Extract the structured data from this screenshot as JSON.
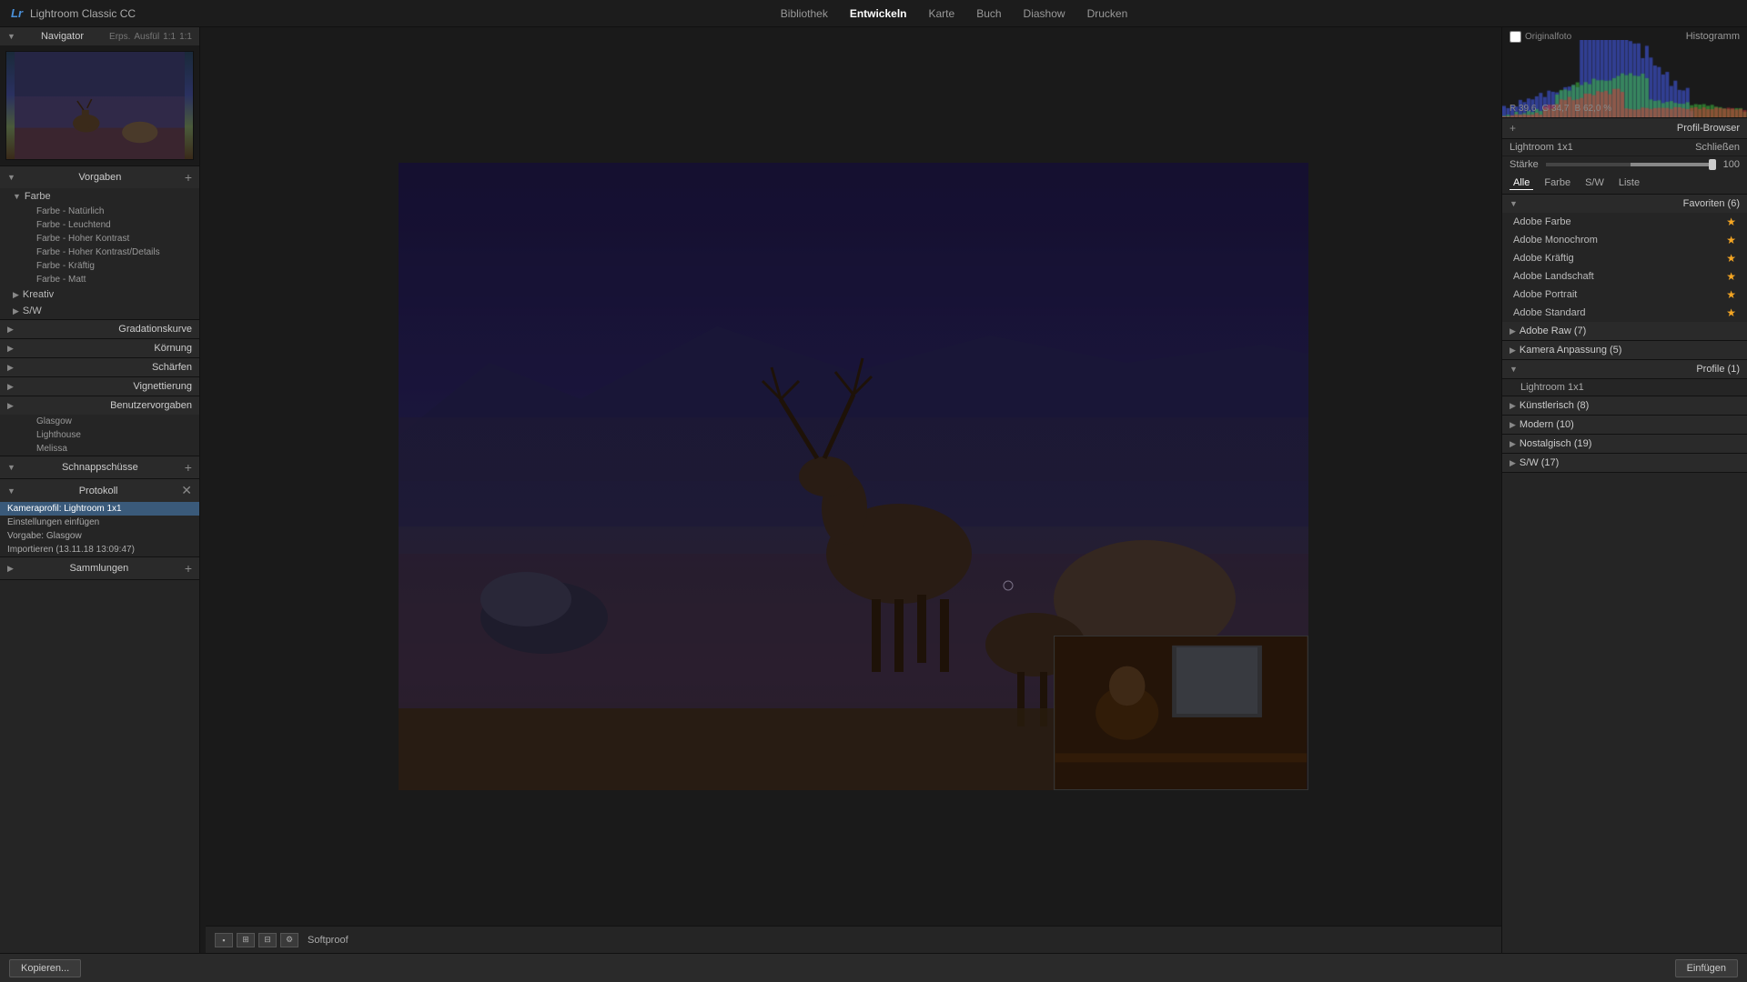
{
  "app": {
    "logo": "Lr",
    "name": "Lightroom Classic CC",
    "nav": [
      {
        "id": "bibliothek",
        "label": "Bibliothek",
        "active": false
      },
      {
        "id": "entwickeln",
        "label": "Entwickeln",
        "active": true
      },
      {
        "id": "karte",
        "label": "Karte",
        "active": false
      },
      {
        "id": "buch",
        "label": "Buch",
        "active": false
      },
      {
        "id": "diashow",
        "label": "Diashow",
        "active": false
      },
      {
        "id": "drucken",
        "label": "Drucken",
        "active": false
      }
    ]
  },
  "left_panel": {
    "navigator": {
      "title": "Navigator",
      "view_options": [
        "Erps.",
        "Ausfül",
        "1:1",
        "1:1"
      ]
    },
    "presets": {
      "title": "Vorgaben",
      "groups": [
        {
          "name": "Farbe",
          "expanded": true,
          "items": [
            {
              "label": "Farbe - Natürlich"
            },
            {
              "label": "Farbe - Leuchtend"
            },
            {
              "label": "Farbe - Hoher Kontrast"
            },
            {
              "label": "Farbe - Hoher Kontrast/Details"
            },
            {
              "label": "Farbe - Kräftig"
            },
            {
              "label": "Farbe - Matt"
            }
          ]
        },
        {
          "name": "Kreativ",
          "expanded": false,
          "items": []
        },
        {
          "name": "S/W",
          "expanded": false,
          "items": []
        }
      ]
    },
    "gradationskurve": {
      "title": "Gradationskurve"
    },
    "kornung": {
      "title": "Körnung"
    },
    "scharfen": {
      "title": "Schärfen"
    },
    "vignettierung": {
      "title": "Vignettierung"
    },
    "benutzervorgaben": {
      "title": "Benutzervorgaben",
      "items": [
        {
          "label": "Glasgow"
        },
        {
          "label": "Lighthouse"
        },
        {
          "label": "Melissa"
        }
      ]
    },
    "schnappschusse": {
      "title": "Schnappschüsse"
    },
    "protokoll": {
      "title": "Protokoll",
      "items": [
        {
          "label": "Kameraprofil: Lightroom 1x1",
          "selected": true
        },
        {
          "label": "Einstellungen einfügen"
        },
        {
          "label": "Vorgabe: Glasgow"
        },
        {
          "label": "Importieren (13.11.18 13:09:47)"
        }
      ]
    },
    "sammlungen": {
      "title": "Sammlungen"
    }
  },
  "histogram": {
    "title": "Histogramm",
    "coords": [
      {
        "label": "R",
        "value": "39,6"
      },
      {
        "label": "G",
        "value": "34,7"
      },
      {
        "label": "B",
        "value": "62,0 %"
      }
    ],
    "checkbox_label": "Originalfoto"
  },
  "profile_browser": {
    "title": "Profil-Browser",
    "close_label": "Schließen",
    "current_profile": "Lightroom 1x1",
    "starke_label": "Stärke",
    "starke_value": "100",
    "filter_tabs": [
      "Alle",
      "Farbe",
      "S/W",
      "Liste"
    ],
    "active_filter": "Alle",
    "sections": [
      {
        "id": "favoriten",
        "title": "Favoriten (6)",
        "expanded": true,
        "items": [
          {
            "label": "Adobe Farbe",
            "starred": true
          },
          {
            "label": "Adobe Monochrom",
            "starred": true
          },
          {
            "label": "Adobe Kräftig",
            "starred": true
          },
          {
            "label": "Adobe Landschaft",
            "starred": true
          },
          {
            "label": "Adobe Portrait",
            "starred": true
          },
          {
            "label": "Adobe Standard",
            "starred": true
          }
        ]
      },
      {
        "id": "adobe-raw",
        "title": "Adobe Raw (7)",
        "expanded": false
      },
      {
        "id": "kamera-anpassung",
        "title": "Kamera Anpassung (5)",
        "expanded": false
      },
      {
        "id": "profile",
        "title": "Profile (1)",
        "expanded": true,
        "items": [
          {
            "label": "Lightroom 1x1"
          }
        ]
      },
      {
        "id": "kunstlerisch",
        "title": "Künstlerisch (8)",
        "expanded": false
      },
      {
        "id": "modern",
        "title": "Modern (10)",
        "expanded": false
      },
      {
        "id": "nostalgisch",
        "title": "Nostalgisch (19)",
        "expanded": false
      },
      {
        "id": "sw",
        "title": "S/W (17)",
        "expanded": false
      }
    ]
  },
  "bottom_bar": {
    "softproof": "Softproof",
    "copy_label": "Kopieren...",
    "paste_label": "Einfügen"
  },
  "colors": {
    "accent_blue": "#4a90d9",
    "panel_bg": "#252525",
    "selected_bg": "#3a5a7a",
    "star_color": "#f5a623"
  }
}
